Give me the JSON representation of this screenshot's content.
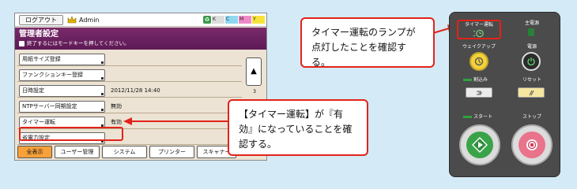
{
  "screen": {
    "logout_label": "ログアウト",
    "user_label": "Admin",
    "toner": [
      "K",
      "C",
      "M",
      "Y"
    ],
    "title": "管理者設定",
    "subtitle": "終了するにはモードキーを押してください。",
    "rows": [
      {
        "label": "用紙サイズ登録",
        "value": ""
      },
      {
        "label": "ファンクションキー登録",
        "value": ""
      },
      {
        "label": "日時設定",
        "value": "2012/11/28 14:40"
      },
      {
        "label": "NTPサーバー同期設定",
        "value": "無効"
      },
      {
        "label": "タイマー運転",
        "value": "有効"
      },
      {
        "label": "省電力設定",
        "value": ""
      }
    ],
    "scroll_up": "▲",
    "page_indicator": "3",
    "tabs": [
      "全表示",
      "ユーザー管理",
      "システム",
      "プリンター",
      "スキャナー"
    ]
  },
  "callouts": {
    "timer_lamp": "タイマー運転のランプが点灯したことを確認する。",
    "timer_setting": "【タイマー運転】が『有効』になっていることを確認する。"
  },
  "panel": {
    "timer_label": "タイマー運転",
    "main_power_label": "主電源",
    "wakeup_label": "ウェイクアップ",
    "power_label": "電源",
    "interrupt_label": "割込み",
    "reset_label": "リセット",
    "start_label": "スタート",
    "stop_label": "ストップ"
  },
  "colors": {
    "accent_red": "#e2231a",
    "header_purple": "#6e2362",
    "selected_tab": "#f7a13a",
    "start_green": "#3aa34a",
    "stop_pink": "#e9738a"
  }
}
